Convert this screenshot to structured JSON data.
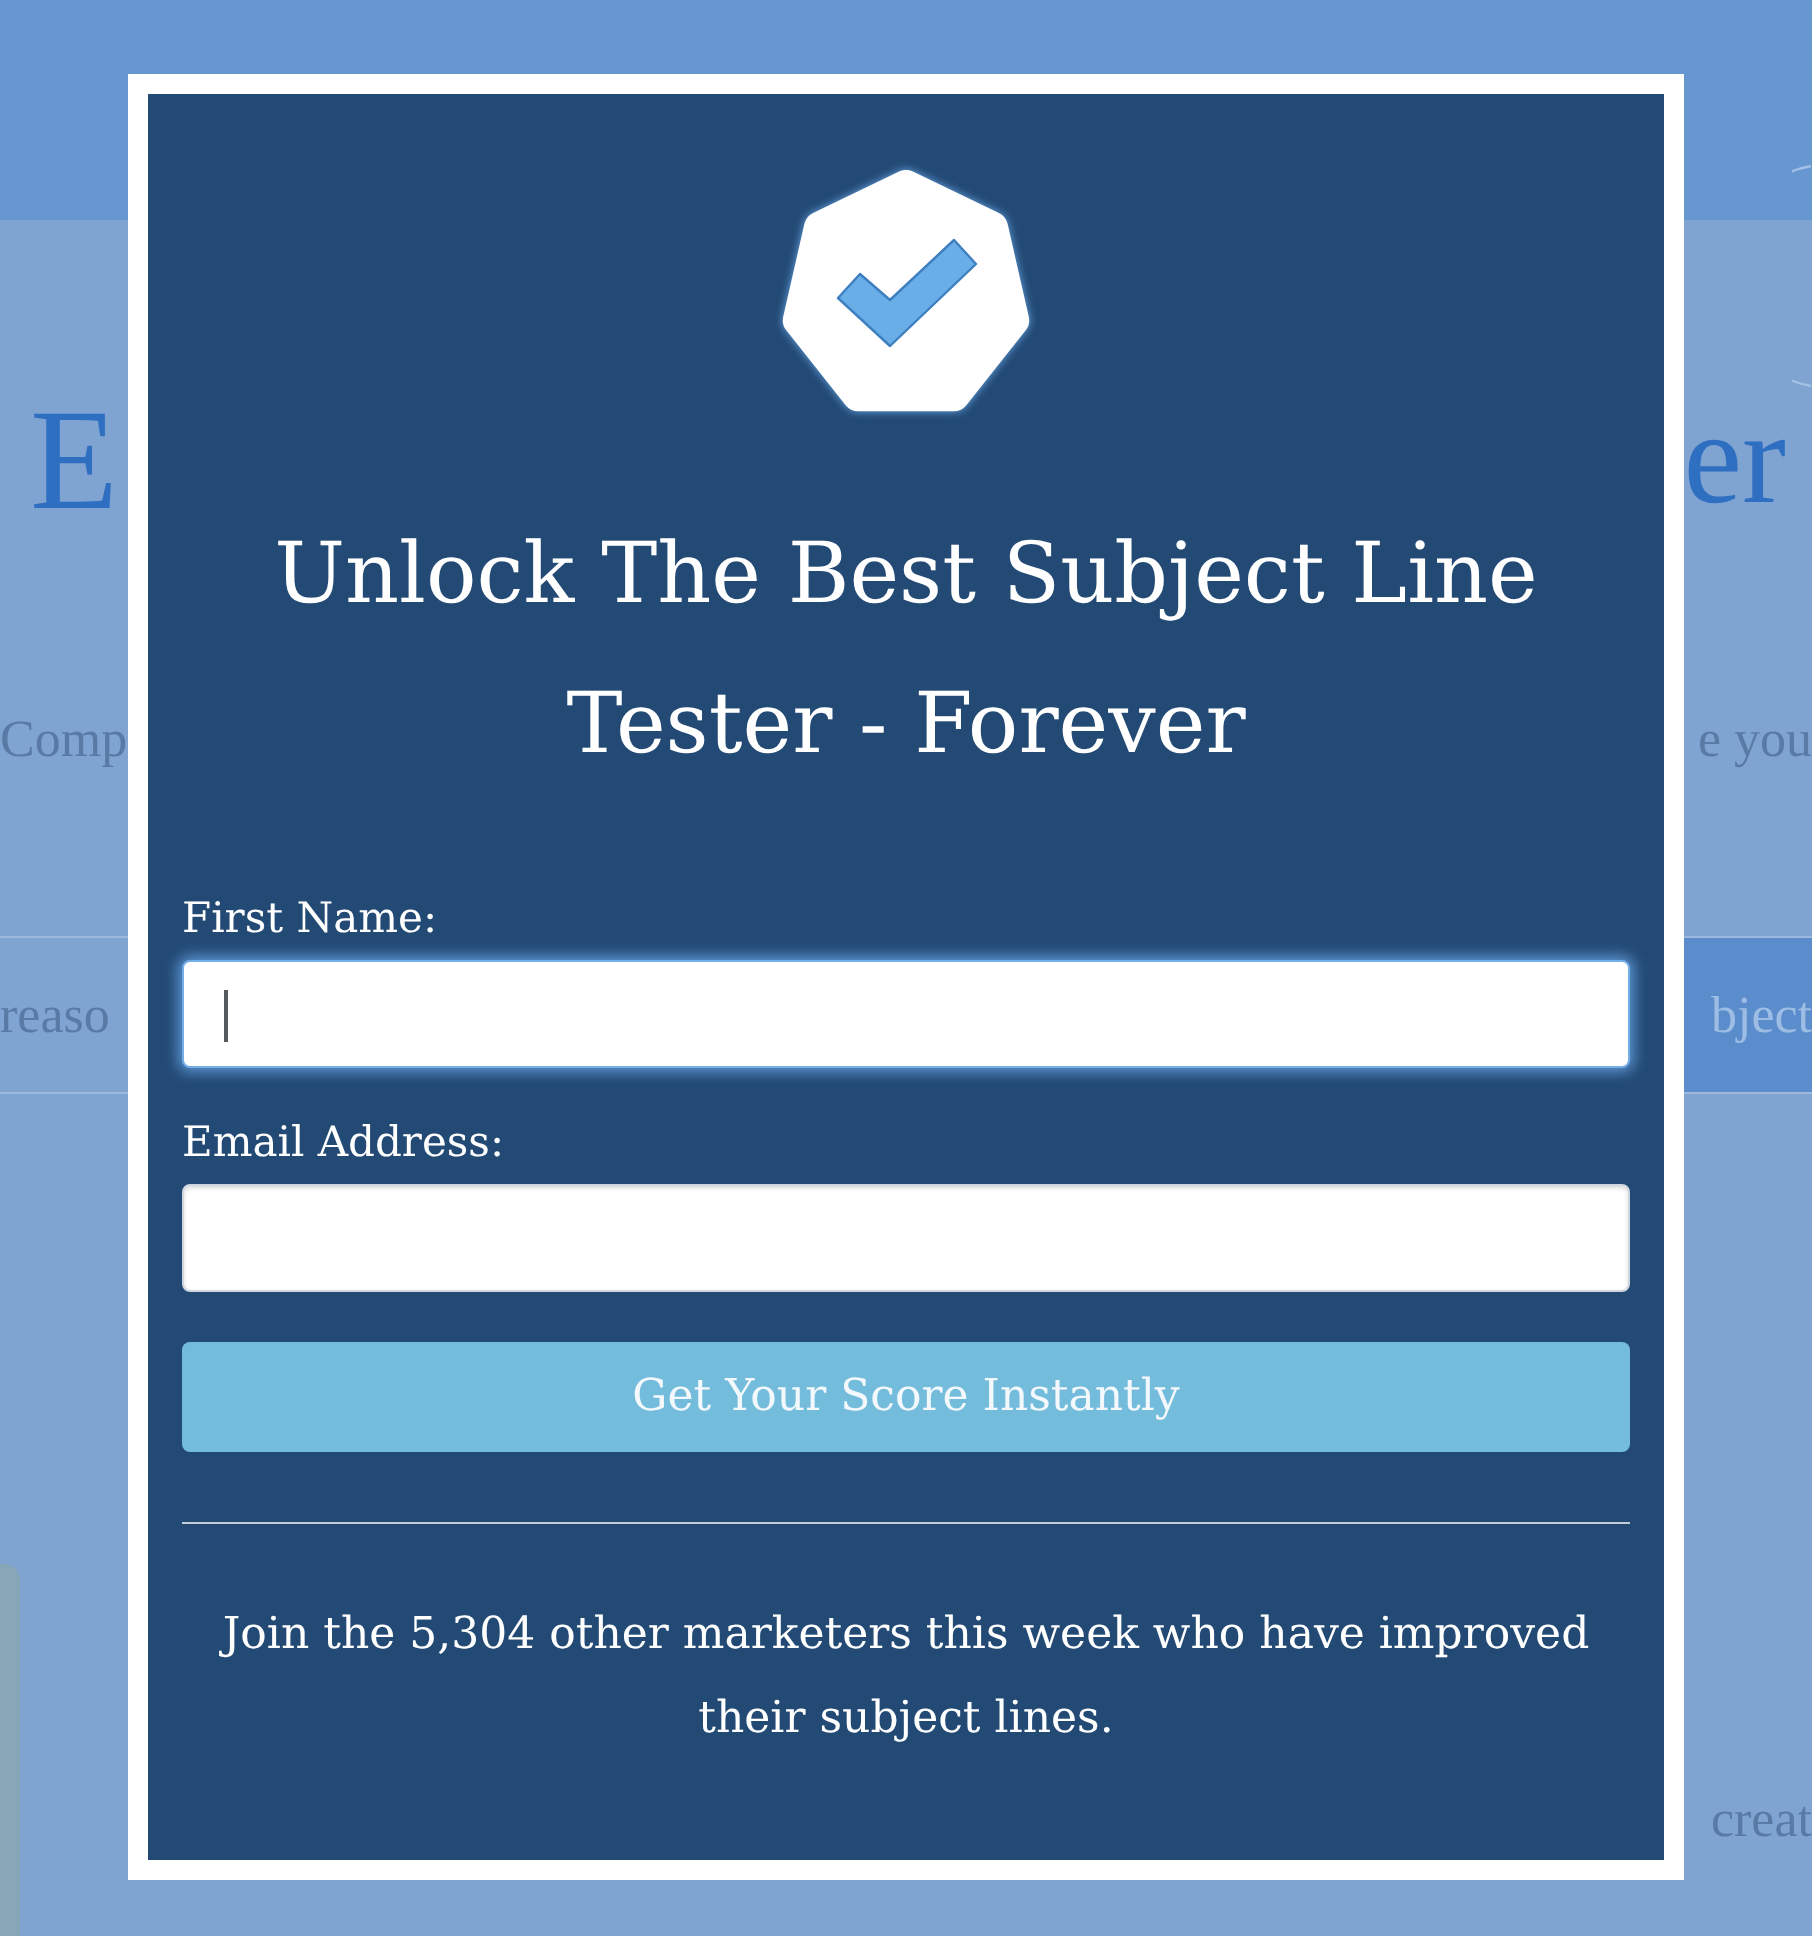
{
  "background": {
    "heading_left": "E",
    "heading_right": "er",
    "intro_left": "Comp",
    "intro_right": "e you",
    "input_placeholder": "reaso",
    "button_label": "bject",
    "text_right": "creat"
  },
  "modal": {
    "title": "Unlock The Best Subject Line Tester - Forever",
    "fields": [
      {
        "label": "First Name:",
        "focused": true
      },
      {
        "label": "Email Address:",
        "focused": false
      }
    ],
    "submit": "Get Your Score Instantly",
    "footer": "Join the 5,304 other marketers this week who have improved their subject lines."
  }
}
